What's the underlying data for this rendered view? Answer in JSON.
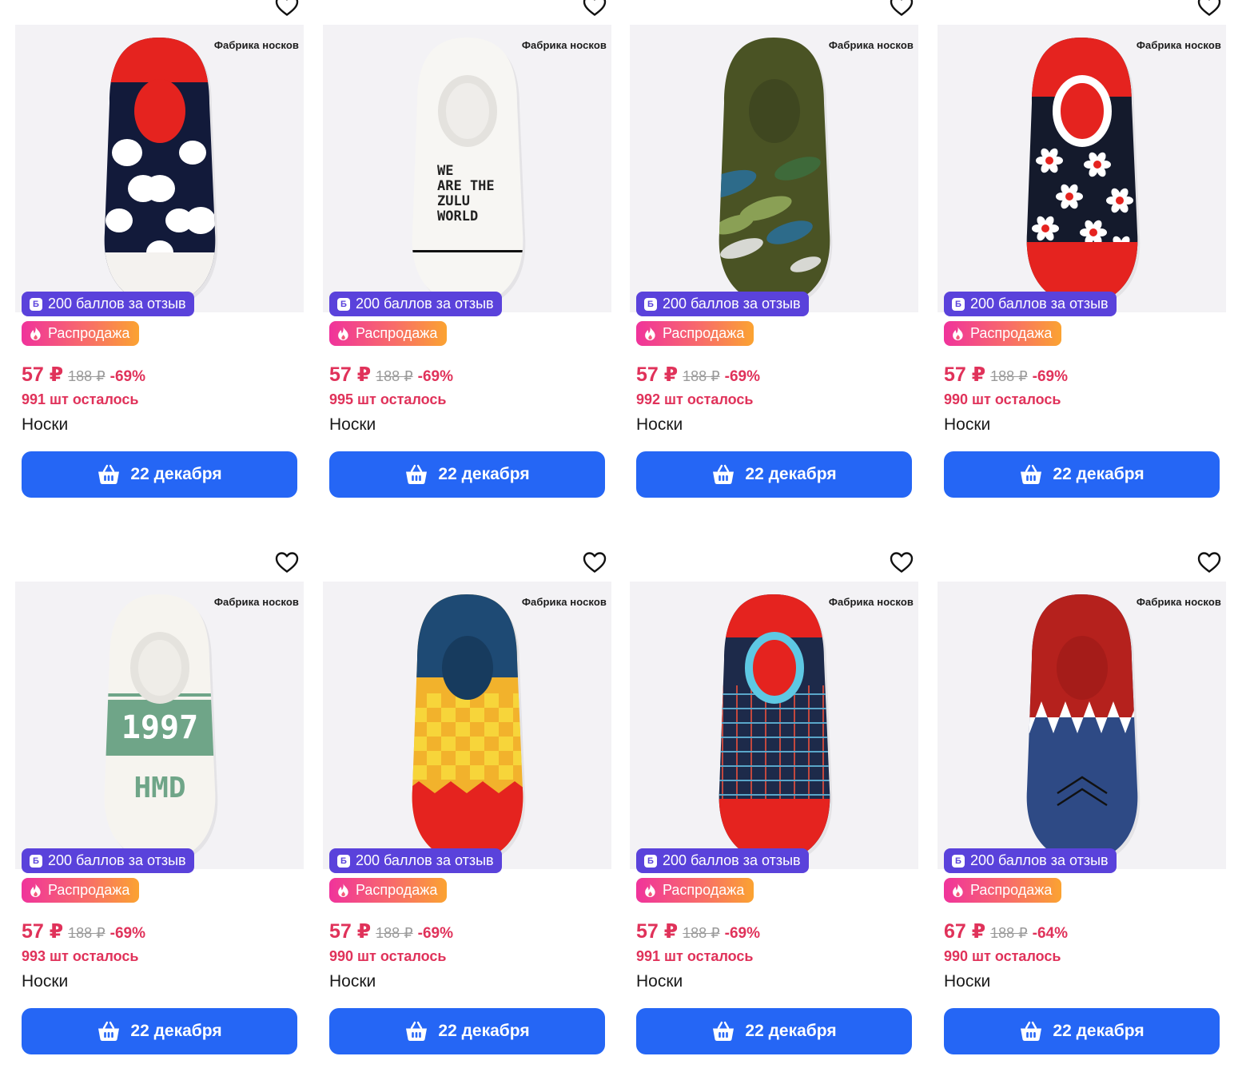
{
  "products": [
    {
      "brand": "Фабрика носков",
      "bonus": "200 баллов за отзыв",
      "bonus_icon": "Б",
      "sale": "Распродажа",
      "price": "57 ₽",
      "old_price": "188 ₽",
      "discount": "-69%",
      "stock": "991 шт осталось",
      "title": "Носки",
      "delivery": "22 декабря",
      "design": "polka"
    },
    {
      "brand": "Фабрика носков",
      "bonus": "200 баллов за отзыв",
      "bonus_icon": "Б",
      "sale": "Распродажа",
      "price": "57 ₽",
      "old_price": "188 ₽",
      "discount": "-69%",
      "stock": "995 шт осталось",
      "title": "Носки",
      "delivery": "22 декабря",
      "design": "zulu",
      "sock_text": [
        "WE",
        "ARE THE",
        "ZULU",
        "WORLD"
      ]
    },
    {
      "brand": "Фабрика носков",
      "bonus": "200 баллов за отзыв",
      "bonus_icon": "Б",
      "sale": "Распродажа",
      "price": "57 ₽",
      "old_price": "188 ₽",
      "discount": "-69%",
      "stock": "992 шт осталось",
      "title": "Носки",
      "delivery": "22 декабря",
      "design": "camo"
    },
    {
      "brand": "Фабрика носков",
      "bonus": "200 баллов за отзыв",
      "bonus_icon": "Б",
      "sale": "Распродажа",
      "price": "57 ₽",
      "old_price": "188 ₽",
      "discount": "-69%",
      "stock": "990 шт осталось",
      "title": "Носки",
      "delivery": "22 декабря",
      "design": "flowers"
    },
    {
      "brand": "Фабрика носков",
      "bonus": "200 баллов за отзыв",
      "bonus_icon": "Б",
      "sale": "Распродажа",
      "price": "57 ₽",
      "old_price": "188 ₽",
      "discount": "-69%",
      "stock": "993 шт осталось",
      "title": "Носки",
      "delivery": "22 декабря",
      "design": "hmd",
      "sock_text": [
        "1997",
        "HMD"
      ]
    },
    {
      "brand": "Фабрика носков",
      "bonus": "200 баллов за отзыв",
      "bonus_icon": "Б",
      "sale": "Распродажа",
      "price": "57 ₽",
      "old_price": "188 ₽",
      "discount": "-69%",
      "stock": "990 шт осталось",
      "title": "Носки",
      "delivery": "22 декабря",
      "design": "checker"
    },
    {
      "brand": "Фабрика носков",
      "bonus": "200 баллов за отзыв",
      "bonus_icon": "Б",
      "sale": "Распродажа",
      "price": "57 ₽",
      "old_price": "188 ₽",
      "discount": "-69%",
      "stock": "991 шт осталось",
      "title": "Носки",
      "delivery": "22 декабря",
      "design": "plaid"
    },
    {
      "brand": "Фабрика носков",
      "bonus": "200 баллов за отзыв",
      "bonus_icon": "Б",
      "sale": "Распродажа",
      "price": "67 ₽",
      "old_price": "188 ₽",
      "discount": "-64%",
      "stock": "990 шт осталось",
      "title": "Носки",
      "delivery": "22 декабря",
      "design": "shark"
    }
  ],
  "colors": {
    "accent": "#2566f5",
    "price": "#e0325a",
    "bonus": "#5a42db",
    "sale_start": "#f0339b",
    "sale_end": "#fba331"
  },
  "icons": {
    "favorite": "heart-icon",
    "bonus": "b-coin-icon",
    "sale": "fire-icon",
    "cart": "basket-icon"
  }
}
